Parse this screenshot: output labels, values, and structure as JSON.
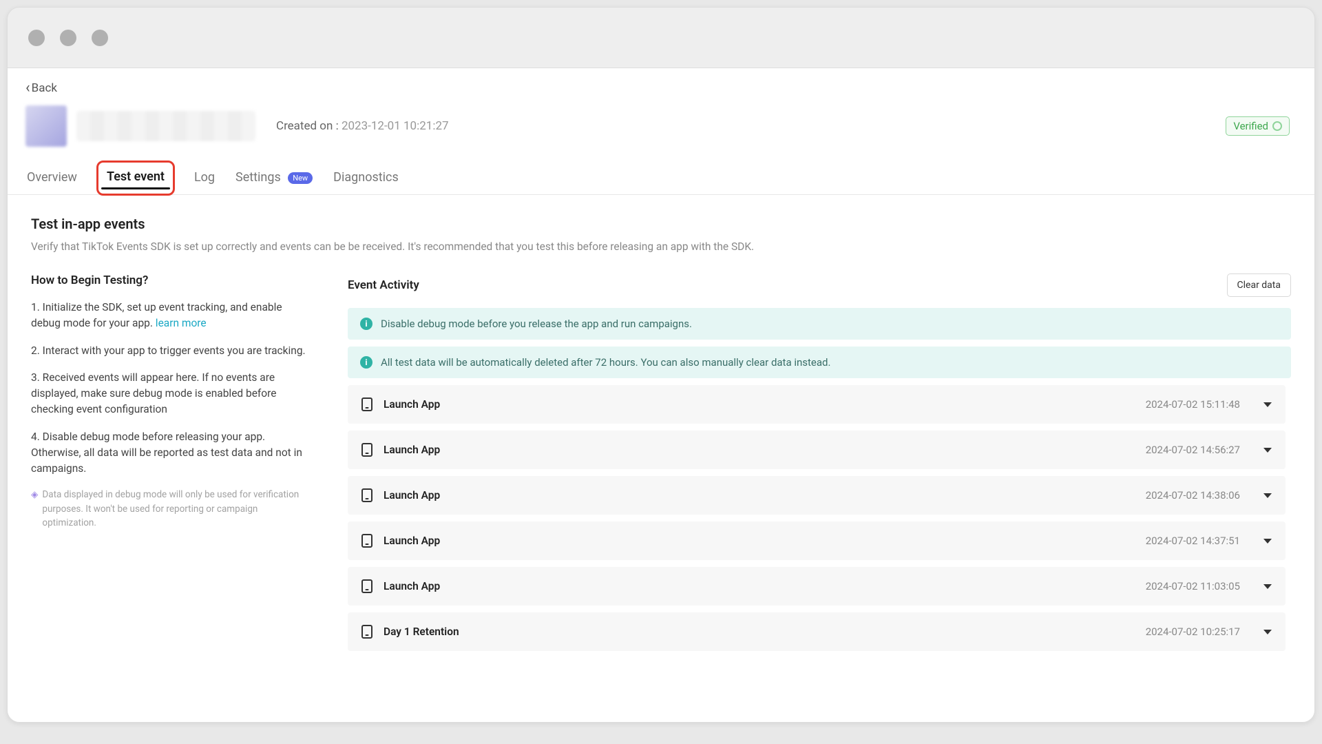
{
  "nav": {
    "back": "Back"
  },
  "header": {
    "created_label": "Created on :",
    "created_value": "2023-12-01 10:21:27",
    "verified": "Verified"
  },
  "tabs": {
    "overview": "Overview",
    "test_event": "Test event",
    "log": "Log",
    "settings": "Settings",
    "settings_badge": "New",
    "diagnostics": "Diagnostics"
  },
  "page": {
    "title": "Test in-app events",
    "desc": "Verify that TikTok Events SDK is set up correctly and events can be be received. It's recommended that you test this before releasing an app with the SDK."
  },
  "howto": {
    "title": "How to Begin Testing?",
    "s1a": "1. Initialize the SDK, set up event tracking, and enable debug mode for your app. ",
    "s1_link": "learn more",
    "s2": "2. Interact with your app to trigger events you are tracking.",
    "s3": "3. Received events will appear here. If no events are displayed, make sure debug mode is enabled before checking event configuration",
    "s4": "4. Disable debug mode before releasing your app. Otherwise, all data will be reported as test data and not in campaigns.",
    "note": "Data displayed in debug mode will only be used for verification purposes. It won't be used for reporting or campaign optimization."
  },
  "activity": {
    "title": "Event Activity",
    "clear": "Clear data",
    "banner1": "Disable debug mode before you release the app and run campaigns.",
    "banner2": "All test data will be automatically deleted after 72 hours. You can also manually clear data instead."
  },
  "events": [
    {
      "name": "Launch App",
      "time": "2024-07-02 15:11:48"
    },
    {
      "name": "Launch App",
      "time": "2024-07-02 14:56:27"
    },
    {
      "name": "Launch App",
      "time": "2024-07-02 14:38:06"
    },
    {
      "name": "Launch App",
      "time": "2024-07-02 14:37:51"
    },
    {
      "name": "Launch App",
      "time": "2024-07-02 11:03:05"
    },
    {
      "name": "Day 1 Retention",
      "time": "2024-07-02 10:25:17"
    }
  ]
}
